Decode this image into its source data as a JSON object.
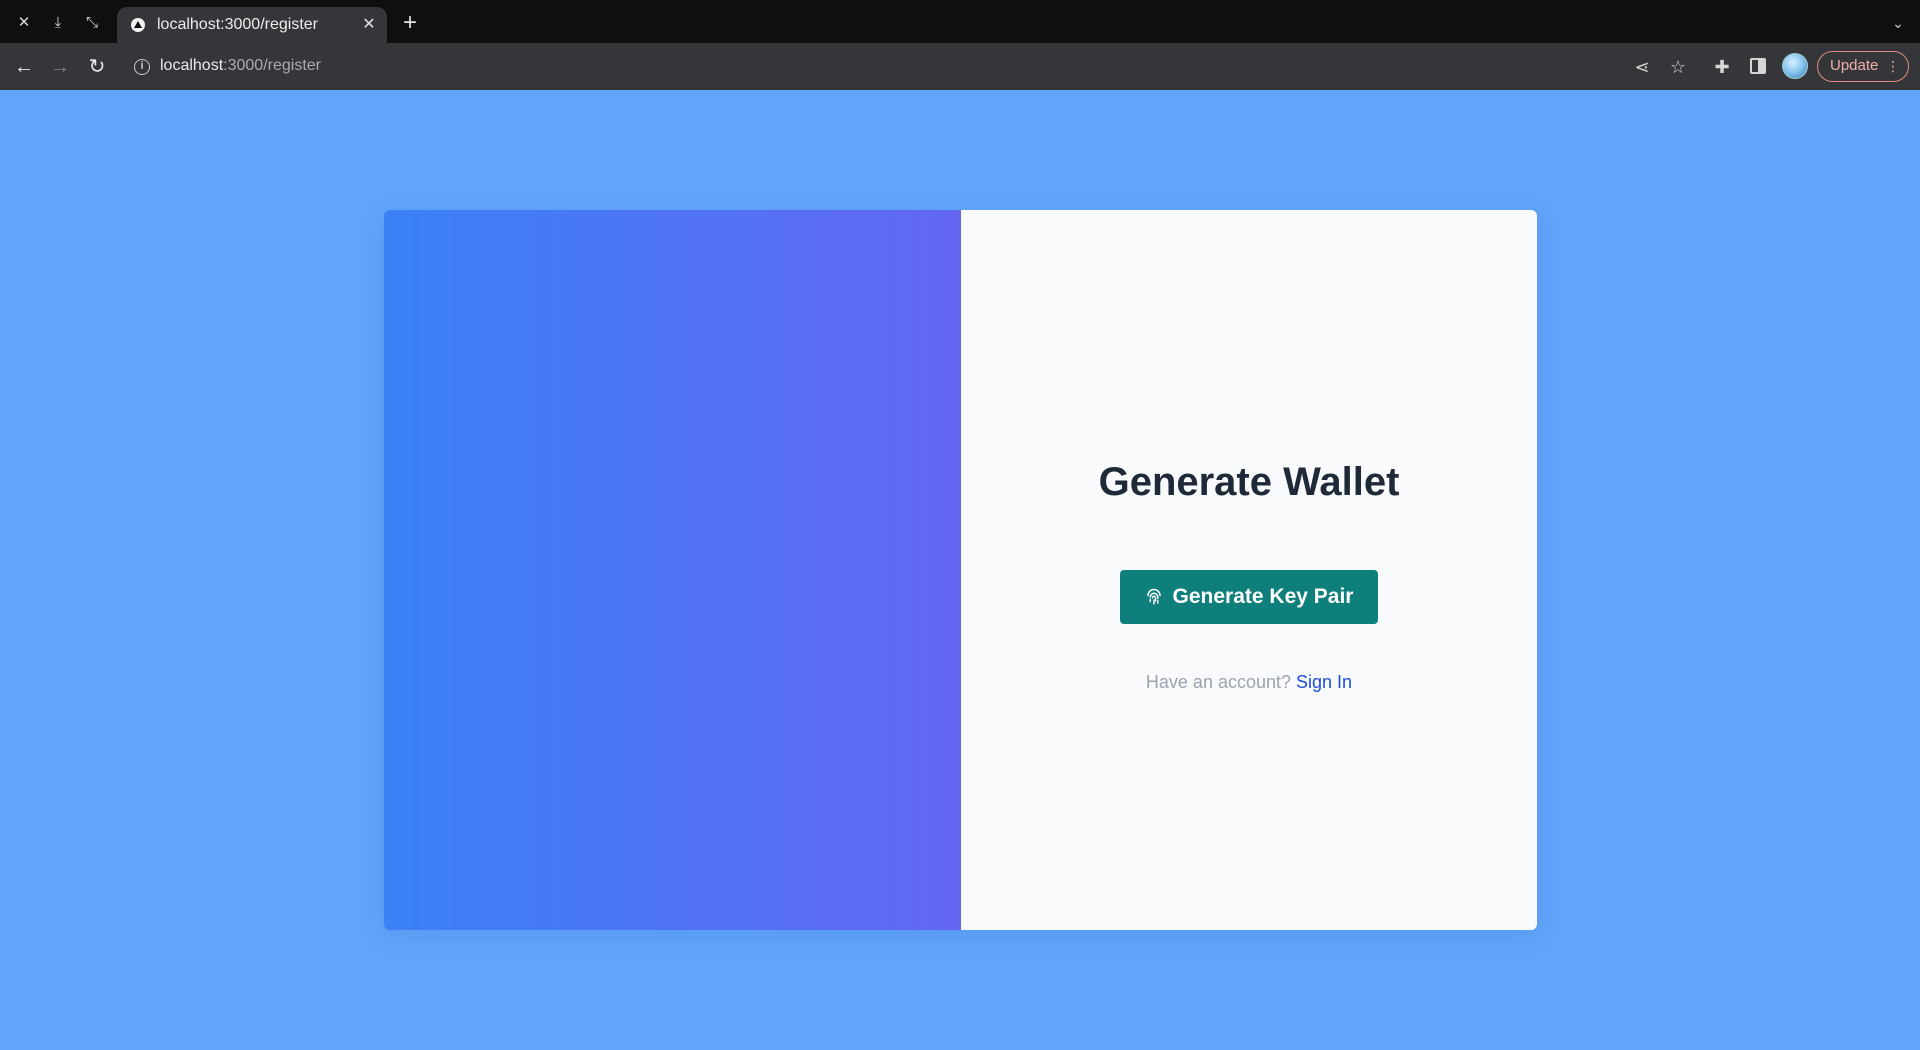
{
  "browser": {
    "tab_title": "localhost:3000/register",
    "url_host": "localhost",
    "url_path": ":3000/register",
    "update_label": "Update"
  },
  "page": {
    "heading": "Generate Wallet",
    "generate_button_label": "Generate Key Pair",
    "have_account_text": "Have an account?",
    "signin_link_label": "Sign In"
  },
  "colors": {
    "page_background": "#60a5fa",
    "gradient_start": "#3b82f6",
    "gradient_end": "#6366f1",
    "button": "#0f7f7c",
    "link": "#1d4ed8"
  },
  "icons": {
    "tab_favicon": "triangle-icon",
    "generate_button_icon": "fingerprint-icon"
  }
}
